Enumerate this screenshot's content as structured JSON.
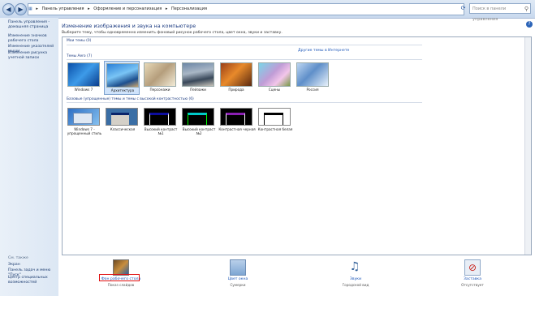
{
  "address": {
    "crumbs": [
      "▸",
      "Панель управления",
      "▸",
      "Оформление и персонализация",
      "▸",
      "Персонализация"
    ],
    "search_placeholder": "Поиск в панели управления"
  },
  "left_pane": {
    "home": "Панель управления - домашняя страница",
    "links": [
      "Изменение значков рабочего стола",
      "Изменение указателей мыши",
      "Изменение рисунка учетной записи"
    ],
    "see_also_header": "См. также",
    "see_also": [
      "Экран",
      "Панель задач и меню \"Пуск\"",
      "Центр специальных возможностей"
    ]
  },
  "main": {
    "title": "Изменение изображения и звука на компьютере",
    "subtitle": "Выберите тему, чтобы одновременно изменить фоновый рисунок рабочего стола, цвет окна, звуки и заставку.",
    "my_themes": "Мои темы (0)",
    "online_link": "Другие темы в Интернете",
    "aero_header": "Темы Aero (7)",
    "aero_themes": [
      "Windows 7",
      "Архитектура",
      "Персонажи",
      "Пейзажи",
      "Природа",
      "Сцены",
      "Россия"
    ],
    "basic_header": "Базовые (упрощенные) темы и темы с высокой контрастностью (6)",
    "basic_themes": [
      "Windows 7 - упрощенный стиль",
      "Классическая",
      "Высокий контраст №1",
      "Высокий контраст №2",
      "Контрастная черная",
      "Контрастная белая"
    ]
  },
  "bottom": {
    "items": [
      {
        "title": "Фон рабочего стола",
        "sub": "Показ слайдов"
      },
      {
        "title": "Цвет окна",
        "sub": "Сумерки"
      },
      {
        "title": "Звуки",
        "sub": "Городской вид"
      },
      {
        "title": "Заставка",
        "sub": "Отсутствует"
      }
    ]
  },
  "colors": {
    "link": "#1a55b8",
    "title": "#1e3d82",
    "highlight": "#e01010"
  }
}
